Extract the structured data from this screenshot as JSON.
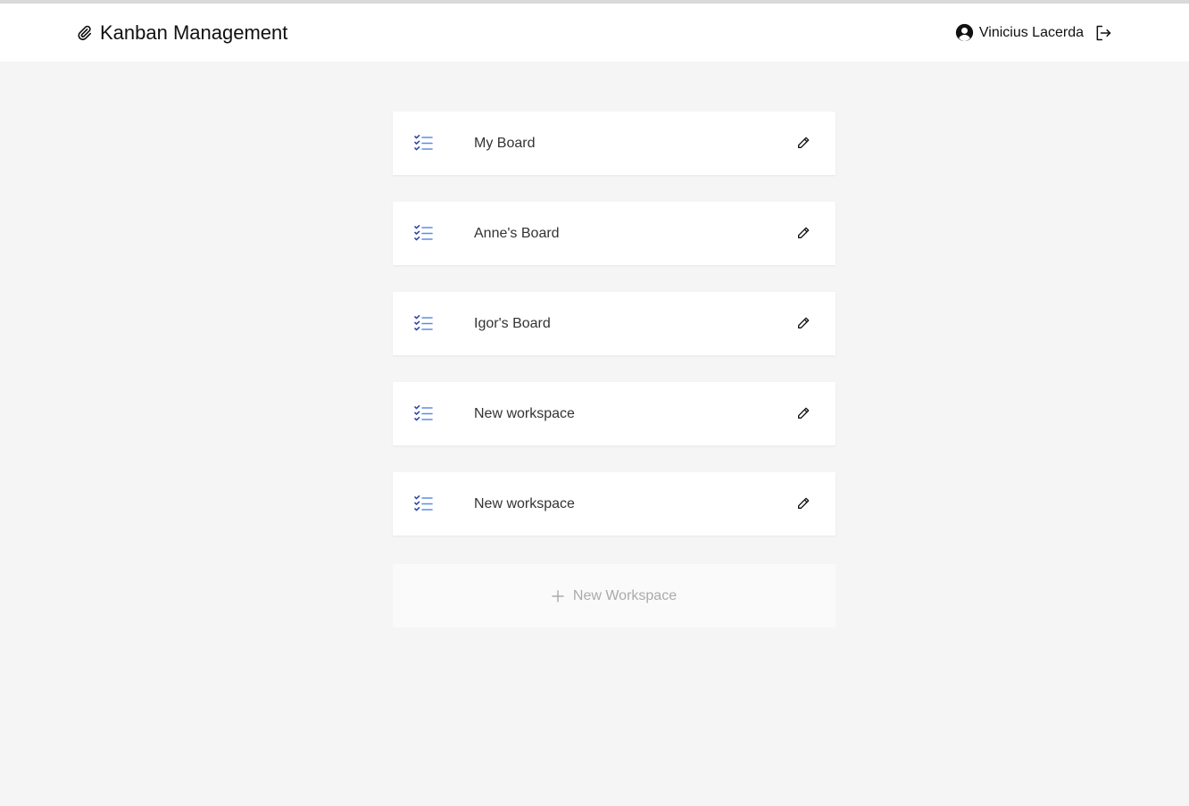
{
  "header": {
    "title": "Kanban Management",
    "user_name": "Vinicius Lacerda"
  },
  "boards": [
    {
      "name": "My Board"
    },
    {
      "name": "Anne's Board"
    },
    {
      "name": "Igor's Board"
    },
    {
      "name": "New workspace"
    },
    {
      "name": "New workspace"
    }
  ],
  "new_workspace_label": "New Workspace",
  "icons": {
    "brand": "paperclip-icon",
    "avatar": "user-circle-icon",
    "logout": "logout-icon",
    "board": "checklist-icon",
    "edit": "pencil-icon",
    "add": "plus-icon"
  },
  "colors": {
    "background": "#f5f5f5",
    "card": "#ffffff",
    "icon_dark": "#2f46a8",
    "icon_light": "#5b8de8",
    "muted_text": "#aaaaaa"
  }
}
